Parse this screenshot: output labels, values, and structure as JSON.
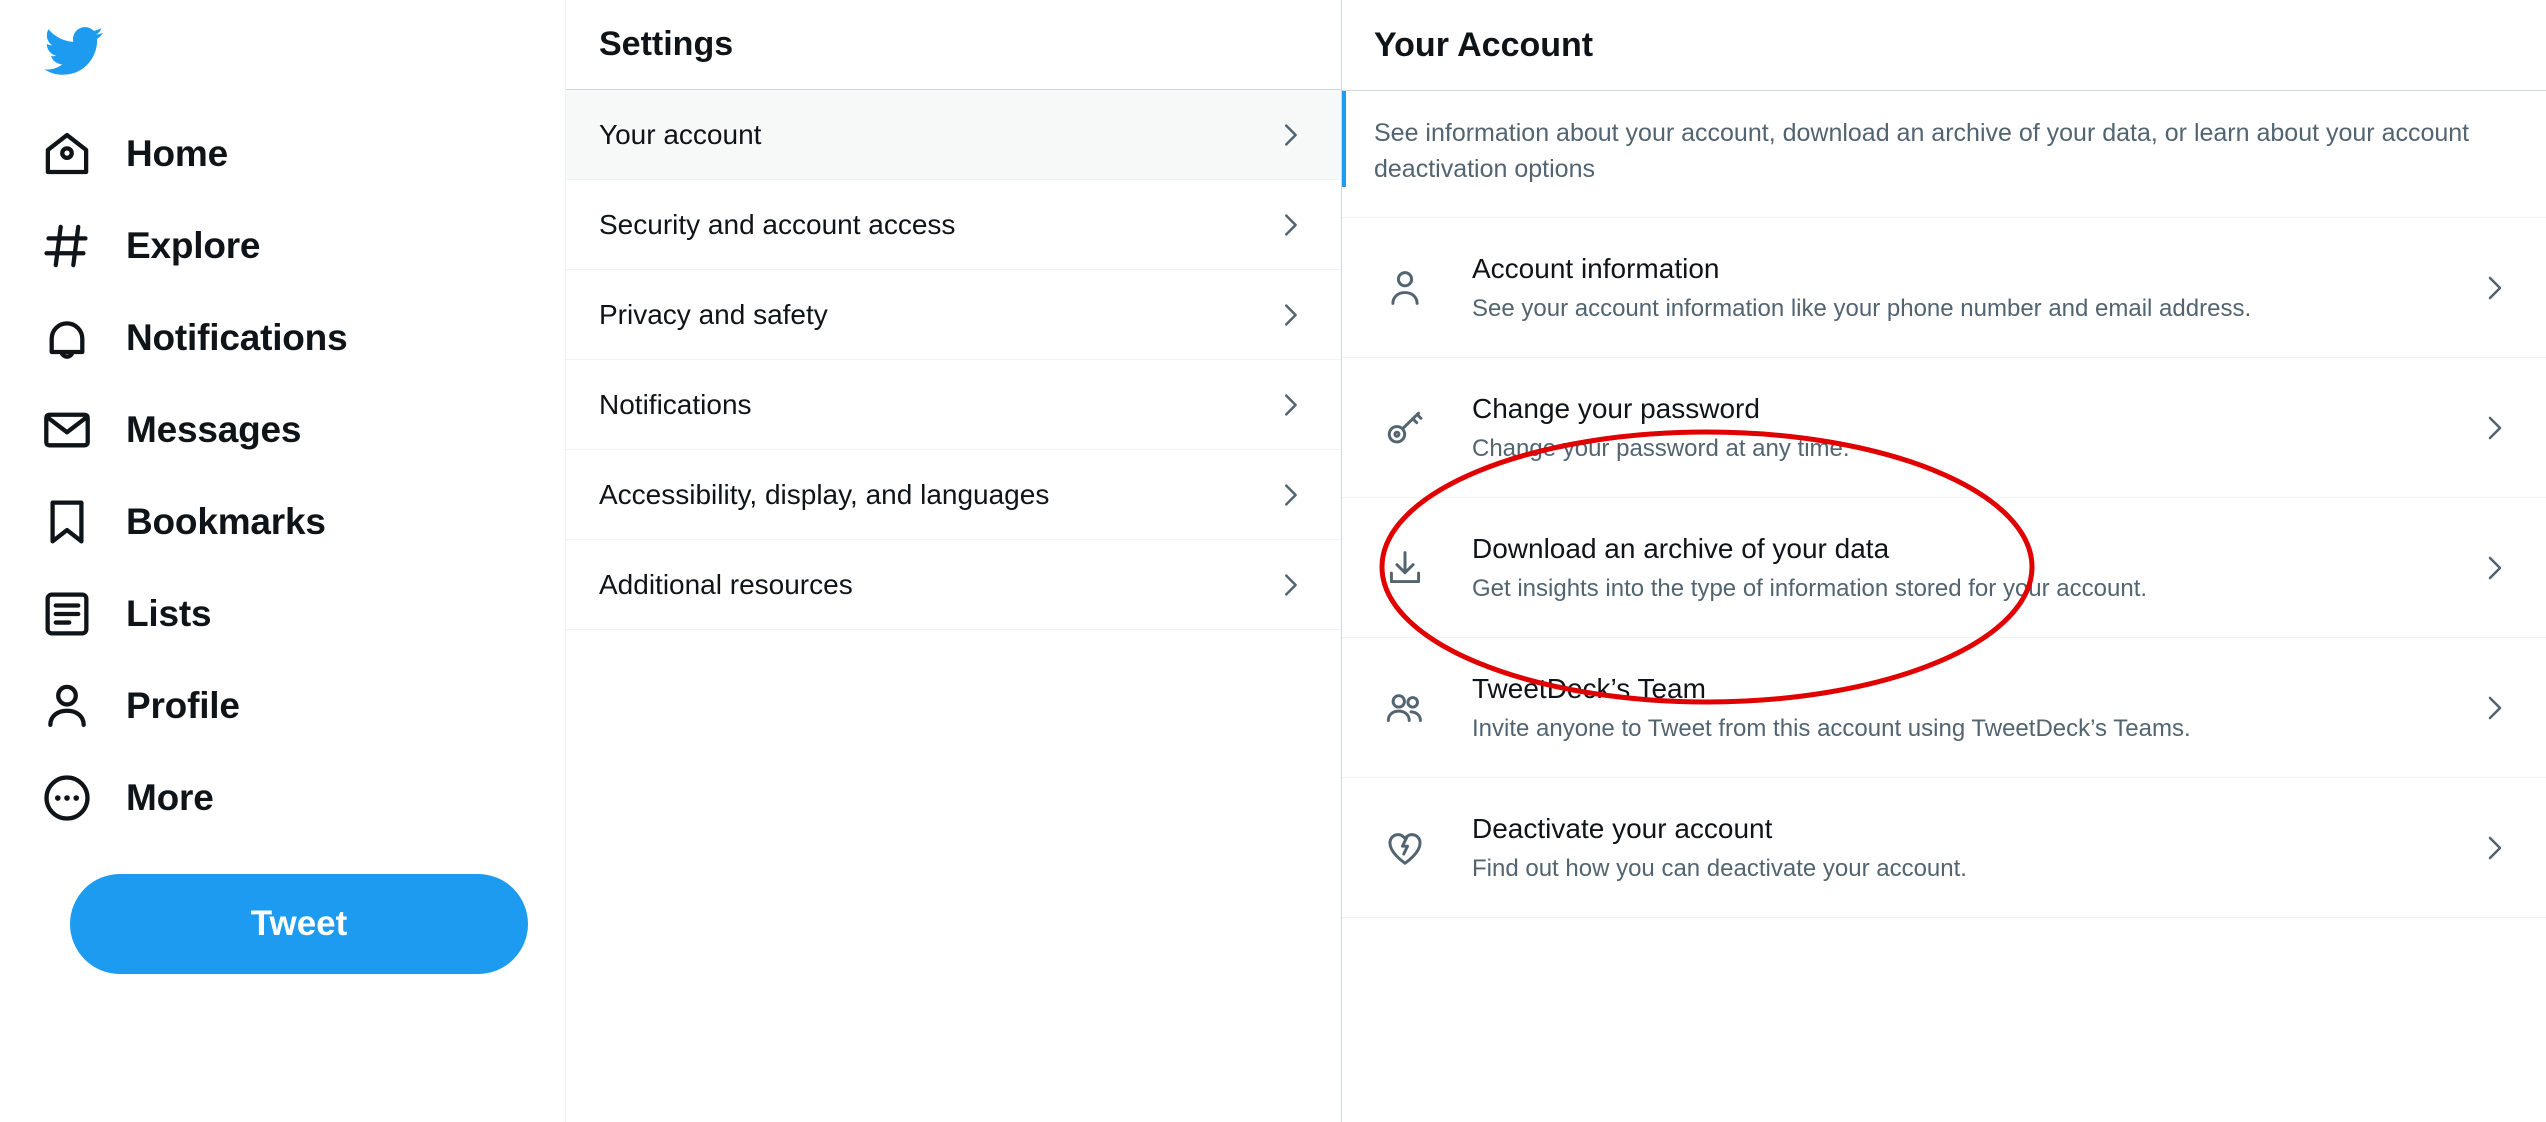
{
  "brand": {
    "logo_icon": "twitter-bird-icon",
    "accent_color": "#1d9bf0",
    "text_color": "#0f1419",
    "muted_color": "#536471",
    "annotation_color": "#e00000"
  },
  "sidebar": {
    "items": [
      {
        "label": "Home",
        "icon": "home-icon"
      },
      {
        "label": "Explore",
        "icon": "hashtag-icon"
      },
      {
        "label": "Notifications",
        "icon": "bell-icon"
      },
      {
        "label": "Messages",
        "icon": "envelope-icon"
      },
      {
        "label": "Bookmarks",
        "icon": "bookmark-icon"
      },
      {
        "label": "Lists",
        "icon": "list-icon"
      },
      {
        "label": "Profile",
        "icon": "person-icon"
      },
      {
        "label": "More",
        "icon": "more-circle-icon"
      }
    ],
    "tweet_button": "Tweet"
  },
  "settings": {
    "title": "Settings",
    "items": [
      {
        "label": "Your account",
        "selected": true
      },
      {
        "label": "Security and account access",
        "selected": false
      },
      {
        "label": "Privacy and safety",
        "selected": false
      },
      {
        "label": "Notifications",
        "selected": false
      },
      {
        "label": "Accessibility, display, and languages",
        "selected": false
      },
      {
        "label": "Additional resources",
        "selected": false
      }
    ]
  },
  "detail": {
    "title": "Your Account",
    "description": "See information about your account, download an archive of your data, or learn about your account deactivation options",
    "options": [
      {
        "title": "Account information",
        "subtitle": "See your account information like your phone number and email address.",
        "icon": "person-icon"
      },
      {
        "title": "Change your password",
        "subtitle": "Change your password at any time.",
        "icon": "key-icon"
      },
      {
        "title": "Download an archive of your data",
        "subtitle": "Get insights into the type of information stored for your account.",
        "icon": "download-icon",
        "annotated": true
      },
      {
        "title": "TweetDeck’s Team",
        "subtitle": "Invite anyone to Tweet from this account using TweetDeck’s Teams.",
        "icon": "people-icon"
      },
      {
        "title": "Deactivate your account",
        "subtitle": "Find out how you can deactivate your account.",
        "icon": "broken-heart-icon"
      }
    ]
  },
  "annotation": {
    "shape": "ellipse",
    "target": "Download an archive of your data",
    "color": "#e00000"
  }
}
